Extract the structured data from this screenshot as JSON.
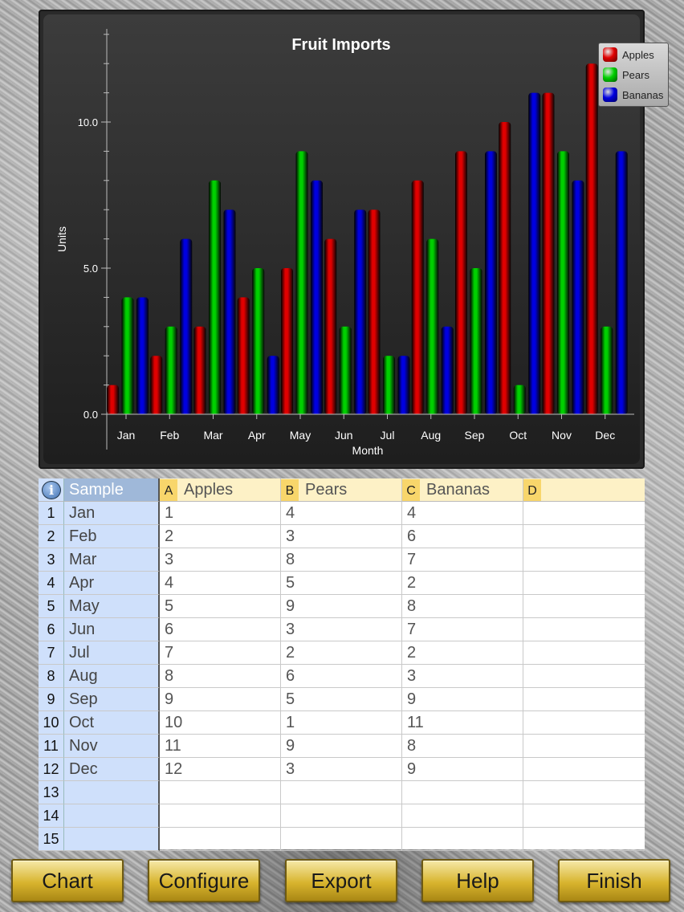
{
  "chart_data": {
    "type": "bar",
    "title": "Fruit Imports",
    "xlabel": "Month",
    "ylabel": "Units",
    "ylim": [
      0,
      13
    ],
    "yticks": [
      "0.0",
      "5.0",
      "10.0"
    ],
    "categories": [
      "Jan",
      "Feb",
      "Mar",
      "Apr",
      "May",
      "Jun",
      "Jul",
      "Aug",
      "Sep",
      "Oct",
      "Nov",
      "Dec"
    ],
    "series": [
      {
        "name": "Apples",
        "color": "#e00000",
        "values": [
          1,
          2,
          3,
          4,
          5,
          6,
          7,
          8,
          9,
          10,
          11,
          12
        ]
      },
      {
        "name": "Pears",
        "color": "#00d000",
        "values": [
          4,
          3,
          8,
          5,
          9,
          3,
          2,
          6,
          5,
          1,
          9,
          3
        ]
      },
      {
        "name": "Bananas",
        "color": "#0000e0",
        "values": [
          4,
          6,
          7,
          2,
          8,
          7,
          2,
          3,
          9,
          11,
          8,
          9
        ]
      }
    ],
    "legend": "top-right",
    "grid": false
  },
  "sheet": {
    "corner_label": "Sample",
    "info_icon": "info-icon",
    "columns": [
      {
        "letter": "A",
        "name": "Apples"
      },
      {
        "letter": "B",
        "name": "Pears"
      },
      {
        "letter": "C",
        "name": "Bananas"
      },
      {
        "letter": "D",
        "name": ""
      }
    ],
    "rows": [
      {
        "num": "1",
        "label": "Jan",
        "cells": [
          "1",
          "4",
          "4",
          ""
        ]
      },
      {
        "num": "2",
        "label": "Feb",
        "cells": [
          "2",
          "3",
          "6",
          ""
        ]
      },
      {
        "num": "3",
        "label": "Mar",
        "cells": [
          "3",
          "8",
          "7",
          ""
        ]
      },
      {
        "num": "4",
        "label": "Apr",
        "cells": [
          "4",
          "5",
          "2",
          ""
        ]
      },
      {
        "num": "5",
        "label": "May",
        "cells": [
          "5",
          "9",
          "8",
          ""
        ]
      },
      {
        "num": "6",
        "label": "Jun",
        "cells": [
          "6",
          "3",
          "7",
          ""
        ]
      },
      {
        "num": "7",
        "label": "Jul",
        "cells": [
          "7",
          "2",
          "2",
          ""
        ]
      },
      {
        "num": "8",
        "label": "Aug",
        "cells": [
          "8",
          "6",
          "3",
          ""
        ]
      },
      {
        "num": "9",
        "label": "Sep",
        "cells": [
          "9",
          "5",
          "9",
          ""
        ]
      },
      {
        "num": "10",
        "label": "Oct",
        "cells": [
          "10",
          "1",
          "11",
          ""
        ]
      },
      {
        "num": "11",
        "label": "Nov",
        "cells": [
          "11",
          "9",
          "8",
          ""
        ]
      },
      {
        "num": "12",
        "label": "Dec",
        "cells": [
          "12",
          "3",
          "9",
          ""
        ]
      },
      {
        "num": "13",
        "label": "",
        "cells": [
          "",
          "",
          "",
          ""
        ]
      },
      {
        "num": "14",
        "label": "",
        "cells": [
          "",
          "",
          "",
          ""
        ]
      },
      {
        "num": "15",
        "label": "",
        "cells": [
          "",
          "",
          "",
          ""
        ]
      }
    ]
  },
  "toolbar": {
    "buttons": [
      "Chart",
      "Configure",
      "Export",
      "Help",
      "Finish"
    ]
  }
}
